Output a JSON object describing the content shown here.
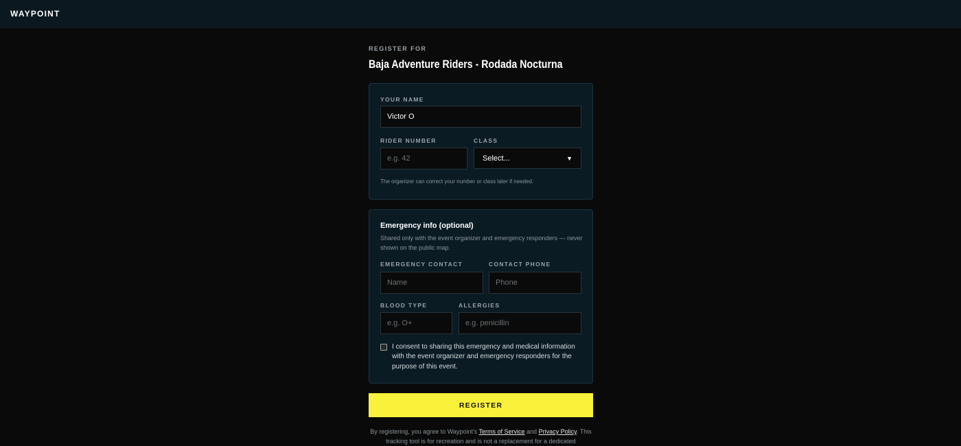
{
  "app": {
    "brand": "WAYPOINT"
  },
  "header": {
    "eyebrow": "REGISTER FOR",
    "event_title": "Baja Adventure Riders - Rodada Nocturna"
  },
  "rider_card": {
    "name_label": "YOUR NAME",
    "name_value": "Victor O",
    "rider_number_label": "RIDER NUMBER",
    "rider_number_placeholder": "e.g. 42",
    "class_label": "CLASS",
    "class_selected": "Select...",
    "hint": "The organizer can correct your number or class later if needed."
  },
  "emergency_card": {
    "title": "Emergency info (optional)",
    "description": "Shared only with the event organizer and emergency responders — never shown on the public map.",
    "contact_label": "EMERGENCY CONTACT",
    "contact_placeholder": "Name",
    "phone_label": "CONTACT PHONE",
    "phone_placeholder": "Phone",
    "blood_label": "BLOOD TYPE",
    "blood_placeholder": "e.g. O+",
    "allergies_label": "ALLERGIES",
    "allergies_placeholder": "e.g. penicillin",
    "consent_text": "I consent to sharing this emergency and medical information with the event organizer and emergency responders for the purpose of this event.",
    "consent_checked": false
  },
  "register_button": "REGISTER",
  "fineprint": {
    "prefix": "By registering, you agree to Waypoint's ",
    "terms_link": "Terms of Service",
    "and": " and ",
    "privacy_link": "Privacy Policy",
    "suffix": ". This tracking tool is for recreation and is not a replacement for a dedicated"
  },
  "colors": {
    "accent": "#faf23a",
    "background": "#0a0a0a",
    "topbar": "#0b1820",
    "card": "#0b1b24"
  }
}
